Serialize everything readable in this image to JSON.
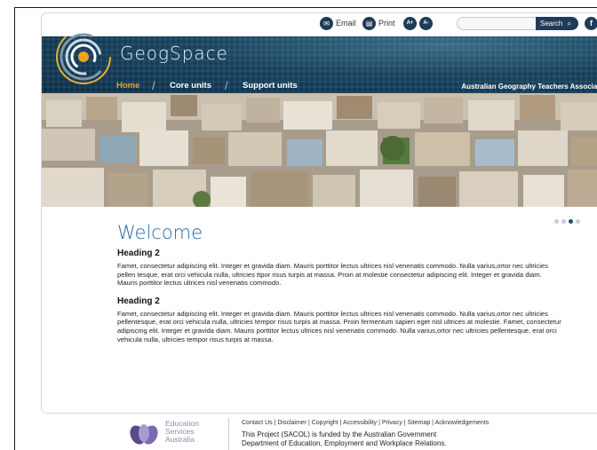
{
  "utility": {
    "email_label": "Email",
    "print_label": "Print",
    "font_increase": "A+",
    "font_decrease": "A-",
    "search_value": "",
    "search_button": "Search"
  },
  "header": {
    "site_title": "GeogSpace",
    "organisation": "Australian Geography Teachers Association"
  },
  "nav": [
    {
      "label": "Home",
      "active": true
    },
    {
      "label": "Core units",
      "active": false
    },
    {
      "label": "Support units",
      "active": false
    }
  ],
  "slider": {
    "slides": 4,
    "active_index": 2
  },
  "content": {
    "title": "Welcome",
    "sections": [
      {
        "heading": "Heading 2",
        "text": "Famet, consectetur adipiscing elit. Integer et gravida diam. Mauris porttitor lectus ultrices nisl venenatis commodo. Nulla varius,ortor nec ultricies pellen tesque, erat orci vehicula nulla, ultricies ttpor risus turpis at massa. Proin at molestie consectetur adipiscing elit. Integer et gravida diam. Mauris porttitor lectus ultrices nisl venenatis commodo."
      },
      {
        "heading": "Heading 2",
        "text": "Famet, consectetur adipiscing elit. Integer et gravida diam. Mauris porttitor lectus ultrices nisl venenatis commodo. Nulla varius,ortor nec ultricies pellentesque, erat orci vehicula nulla, ultricies tempor risus turpis at massa. Proin fermentum sapien eget nisl ultrices at molestie. Famet, consectetur adipiscing elit. Integer et gravida diam. Mauris porttitor lectus ultrices nisl venenatis commodo. Nulla varius,ortor nec ultricies pellentesque, erat orci vehicula nulla, ultricies tempor risus turpis at massa."
      }
    ]
  },
  "footer": {
    "esa_line1": "Education",
    "esa_line2": "Services",
    "esa_line3": "Australia",
    "links": [
      "Contact Us",
      "Disclaimer",
      "Copyright",
      "Accessibility",
      "Privacy",
      "Sitemap",
      "Acknowledgements"
    ],
    "funding_line1": "This Project (SACOL) is funded by the Australian Government",
    "funding_line2": "Department of Education, Employment and Workplace Relations."
  },
  "colors": {
    "brand_dark": "#1f3b57",
    "header": "#17425e",
    "title_blue": "#2a6aa0",
    "nav_active": "#f0a020"
  }
}
